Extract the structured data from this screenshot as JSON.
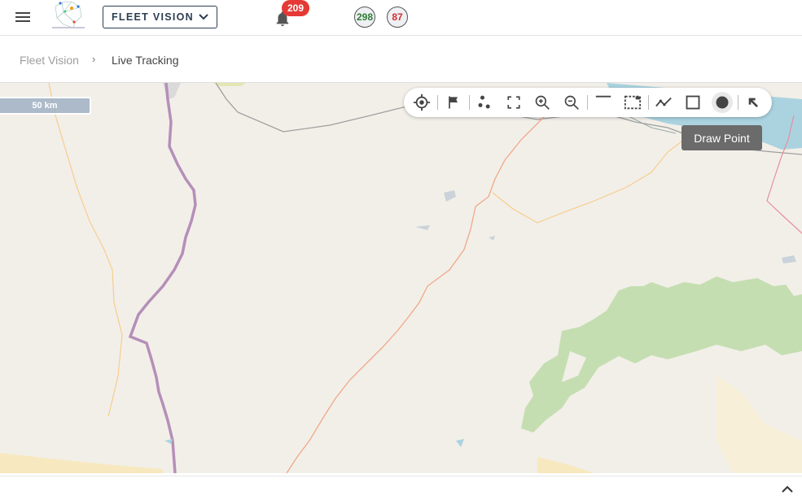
{
  "header": {
    "app_selector_label": "FLEET VISION",
    "notification_count": "209",
    "online_count": "298",
    "offline_count": "87"
  },
  "breadcrumb": {
    "items": [
      "Fleet Vision",
      "Live Tracking"
    ]
  },
  "map": {
    "scale_label": "50 km",
    "tooltip": "Draw Point",
    "toolbar": [
      {
        "name": "locate",
        "icon": "crosshair-icon"
      },
      {
        "name": "flag",
        "icon": "flag-icon"
      },
      {
        "name": "cluster",
        "icon": "cluster-icon"
      },
      {
        "name": "fullscreen",
        "icon": "fullscreen-icon"
      },
      {
        "name": "zoom-in",
        "icon": "zoom-in-icon"
      },
      {
        "name": "zoom-out",
        "icon": "zoom-out-icon"
      },
      {
        "name": "draw-line",
        "icon": "line-icon"
      },
      {
        "name": "select-area",
        "icon": "dashed-rectangle-icon"
      },
      {
        "name": "draw-polyline",
        "icon": "polyline-icon"
      },
      {
        "name": "draw-rectangle",
        "icon": "square-icon"
      },
      {
        "name": "draw-point",
        "icon": "circle-icon",
        "active": true
      },
      {
        "name": "collapse",
        "icon": "arrow-up-left-icon"
      }
    ]
  },
  "colors": {
    "primary": "#2c3e50",
    "badge": "#e53935",
    "online": "#2e7d32",
    "offline": "#d32f2f",
    "map_land": "#f2efe9",
    "map_forest": "#c5deb1",
    "map_water": "#aad3df"
  }
}
